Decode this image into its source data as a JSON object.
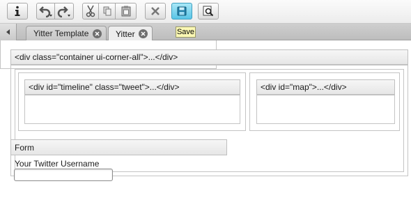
{
  "toolbar": {
    "buttons": [
      {
        "name": "info",
        "icon": "info-icon"
      },
      {
        "name": "undo",
        "icon": "undo-icon"
      },
      {
        "name": "redo",
        "icon": "redo-icon"
      },
      {
        "name": "cut",
        "icon": "scissors-icon"
      },
      {
        "name": "copy",
        "icon": "copy-icon"
      },
      {
        "name": "paste",
        "icon": "clipboard-icon"
      },
      {
        "name": "delete",
        "icon": "x-icon"
      },
      {
        "name": "save",
        "icon": "save-icon",
        "active": true
      },
      {
        "name": "preview",
        "icon": "preview-icon"
      }
    ],
    "save_tooltip": "Save"
  },
  "tabs": [
    {
      "label": "Yitter Template",
      "active": false
    },
    {
      "label": "Yitter",
      "active": true
    }
  ],
  "canvas": {
    "container_tag": "<div class=\"container ui-corner-all\">...</div>",
    "timeline_tag": "<div id=\"timeline\" class=\"tweet\">...</div>",
    "map_tag": "<div id=\"map\">...</div>",
    "form_title": "Form",
    "form_label": "Your Twitter Username",
    "username_value": ""
  },
  "colors": {
    "accent_save": "#59c4e6",
    "tooltip_bg": "#fbf8b4"
  }
}
